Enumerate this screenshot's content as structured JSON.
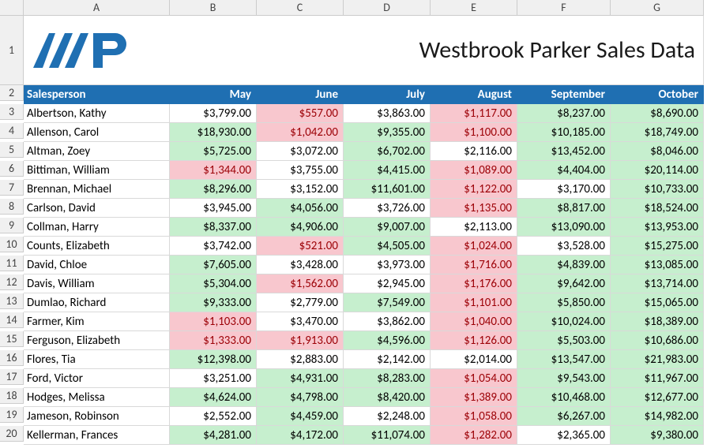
{
  "title": "Westbrook Parker Sales Data",
  "columns_letters": [
    "A",
    "B",
    "C",
    "D",
    "E",
    "F",
    "G"
  ],
  "header": {
    "salesperson": "Salesperson",
    "months": [
      "May",
      "June",
      "July",
      "August",
      "September",
      "October"
    ]
  },
  "chart_data": {
    "type": "table",
    "title": "Westbrook Parker Sales Data",
    "columns": [
      "Salesperson",
      "May",
      "June",
      "July",
      "August",
      "September",
      "October"
    ],
    "rows": [
      {
        "name": "Albertson, Kathy",
        "values": [
          3799.0,
          557.0,
          3863.0,
          1117.0,
          8237.0,
          8690.0
        ],
        "hl": [
          "",
          "red",
          "",
          "red",
          "green",
          "green"
        ]
      },
      {
        "name": "Allenson, Carol",
        "values": [
          18930.0,
          1042.0,
          9355.0,
          1100.0,
          10185.0,
          18749.0
        ],
        "hl": [
          "green",
          "red",
          "green",
          "red",
          "green",
          "green"
        ]
      },
      {
        "name": "Altman, Zoey",
        "values": [
          5725.0,
          3072.0,
          6702.0,
          2116.0,
          13452.0,
          8046.0
        ],
        "hl": [
          "green",
          "",
          "green",
          "",
          "green",
          "green"
        ]
      },
      {
        "name": "Bittiman, William",
        "values": [
          1344.0,
          3755.0,
          4415.0,
          1089.0,
          4404.0,
          20114.0
        ],
        "hl": [
          "red",
          "",
          "green",
          "red",
          "green",
          "green"
        ]
      },
      {
        "name": "Brennan, Michael",
        "values": [
          8296.0,
          3152.0,
          11601.0,
          1122.0,
          3170.0,
          10733.0
        ],
        "hl": [
          "green",
          "",
          "green",
          "red",
          "",
          "green"
        ]
      },
      {
        "name": "Carlson, David",
        "values": [
          3945.0,
          4056.0,
          3726.0,
          1135.0,
          8817.0,
          18524.0
        ],
        "hl": [
          "",
          "green",
          "",
          "red",
          "green",
          "green"
        ]
      },
      {
        "name": "Collman, Harry",
        "values": [
          8337.0,
          4906.0,
          9007.0,
          2113.0,
          13090.0,
          13953.0
        ],
        "hl": [
          "green",
          "green",
          "green",
          "",
          "green",
          "green"
        ]
      },
      {
        "name": "Counts, Elizabeth",
        "values": [
          3742.0,
          521.0,
          4505.0,
          1024.0,
          3528.0,
          15275.0
        ],
        "hl": [
          "",
          "red",
          "green",
          "red",
          "",
          "green"
        ]
      },
      {
        "name": "David, Chloe",
        "values": [
          7605.0,
          3428.0,
          3973.0,
          1716.0,
          4839.0,
          13085.0
        ],
        "hl": [
          "green",
          "",
          "",
          "red",
          "green",
          "green"
        ]
      },
      {
        "name": "Davis, William",
        "values": [
          5304.0,
          1562.0,
          2945.0,
          1176.0,
          9642.0,
          13714.0
        ],
        "hl": [
          "green",
          "red",
          "",
          "red",
          "green",
          "green"
        ]
      },
      {
        "name": "Dumlao, Richard",
        "values": [
          9333.0,
          2779.0,
          7549.0,
          1101.0,
          5850.0,
          15065.0
        ],
        "hl": [
          "green",
          "",
          "green",
          "red",
          "green",
          "green"
        ]
      },
      {
        "name": "Farmer, Kim",
        "values": [
          1103.0,
          3470.0,
          3862.0,
          1040.0,
          10024.0,
          18389.0
        ],
        "hl": [
          "red",
          "",
          "",
          "red",
          "green",
          "green"
        ]
      },
      {
        "name": "Ferguson, Elizabeth",
        "values": [
          1333.0,
          1913.0,
          4596.0,
          1126.0,
          5503.0,
          10686.0
        ],
        "hl": [
          "red",
          "red",
          "green",
          "red",
          "green",
          "green"
        ]
      },
      {
        "name": "Flores, Tia",
        "values": [
          12398.0,
          2883.0,
          2142.0,
          2014.0,
          13547.0,
          21983.0
        ],
        "hl": [
          "green",
          "",
          "",
          "",
          "green",
          "green"
        ]
      },
      {
        "name": "Ford, Victor",
        "values": [
          3251.0,
          4931.0,
          8283.0,
          1054.0,
          9543.0,
          11967.0
        ],
        "hl": [
          "",
          "green",
          "green",
          "red",
          "green",
          "green"
        ]
      },
      {
        "name": "Hodges, Melissa",
        "values": [
          4624.0,
          4798.0,
          8420.0,
          1389.0,
          10468.0,
          12677.0
        ],
        "hl": [
          "green",
          "green",
          "green",
          "red",
          "green",
          "green"
        ]
      },
      {
        "name": "Jameson, Robinson",
        "values": [
          2552.0,
          4459.0,
          2248.0,
          1058.0,
          6267.0,
          14982.0
        ],
        "hl": [
          "",
          "green",
          "",
          "red",
          "green",
          "green"
        ]
      },
      {
        "name": "Kellerman, Frances",
        "values": [
          4281.0,
          4172.0,
          11074.0,
          1282.0,
          2365.0,
          9380.0
        ],
        "hl": [
          "green",
          "green",
          "green",
          "red",
          "",
          "green"
        ]
      }
    ]
  }
}
